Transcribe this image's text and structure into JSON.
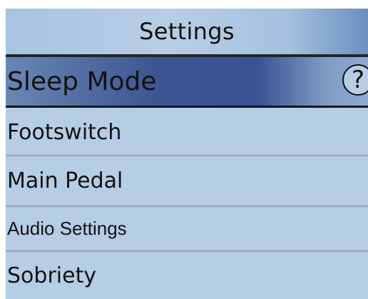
{
  "header": {
    "title": "Settings"
  },
  "menu": {
    "items": [
      {
        "label": "Sleep Mode",
        "selected": true,
        "help_icon": "?"
      },
      {
        "label": "Footswitch",
        "selected": false
      },
      {
        "label": "Main Pedal",
        "selected": false
      },
      {
        "label": "Audio Settings",
        "selected": false
      },
      {
        "label": "Sobriety",
        "selected": false
      }
    ]
  },
  "colors": {
    "background": "#b5cde5",
    "selected_row": "#3e5793",
    "text": "#121212"
  }
}
